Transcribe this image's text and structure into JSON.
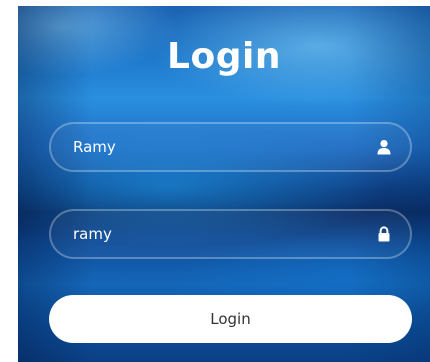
{
  "form": {
    "title": "Login",
    "username": {
      "value": "Ramy",
      "icon": "user-icon"
    },
    "password": {
      "value": "ramy",
      "icon": "lock-icon"
    },
    "submit_label": "Login"
  },
  "colors": {
    "background_primary": "#1a6fc2",
    "background_dark": "#0b2d66",
    "field_border": "#ffffff",
    "button_bg": "#ffffff",
    "button_text": "#333333",
    "text": "#ffffff"
  }
}
